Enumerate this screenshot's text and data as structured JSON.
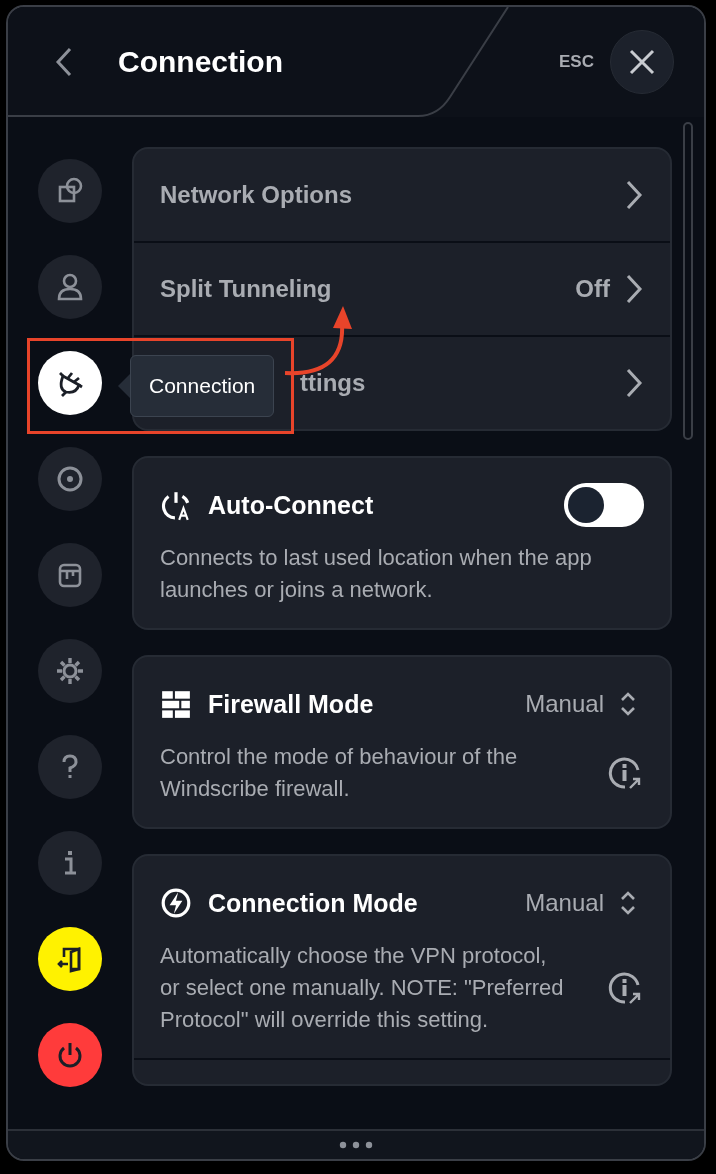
{
  "header": {
    "title": "Connection",
    "esc_label": "ESC"
  },
  "sidebar": {
    "items": [
      {
        "selected": false
      },
      {
        "selected": false
      },
      {
        "selected": true
      },
      {
        "selected": false
      },
      {
        "selected": false
      },
      {
        "selected": false
      },
      {
        "selected": false
      },
      {
        "selected": false
      },
      {
        "selected": false
      },
      {
        "selected": false
      }
    ]
  },
  "tooltip": {
    "text": "Connection"
  },
  "nav_rows": [
    {
      "label": "Network Options"
    },
    {
      "label": "Split Tunneling",
      "value": "Off"
    },
    {
      "label": "ttings"
    }
  ],
  "settings": [
    {
      "kind": "toggle",
      "title": "Auto-Connect",
      "on": false,
      "description": "Connects to last used location when the app launches or joins a network."
    },
    {
      "kind": "select",
      "title": "Firewall Mode",
      "value": "Manual",
      "description": "Control the mode of behaviour of the Windscribe firewall."
    },
    {
      "kind": "select",
      "title": "Connection Mode",
      "value": "Manual",
      "description": "Automatically choose the VPN protocol, or select one manually. NOTE: \"Preferred Protocol\" will override this setting."
    }
  ]
}
